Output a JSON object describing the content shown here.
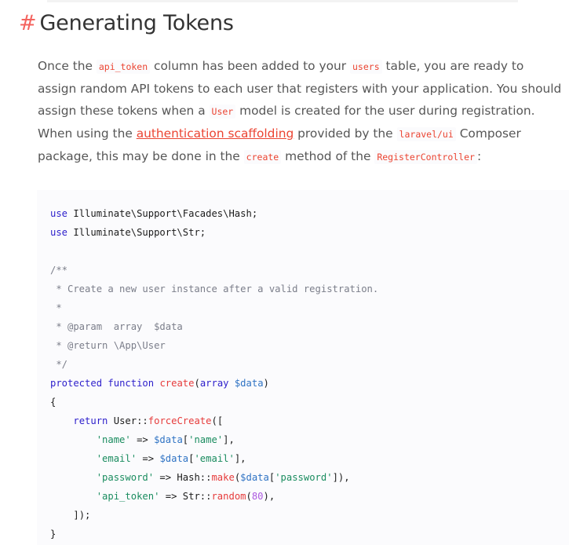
{
  "heading": {
    "hash": "#",
    "title": "Generating Tokens"
  },
  "paragraph": {
    "l1_a": "Once the ",
    "l1_code1": "api_token",
    "l1_b": " column has been added to your ",
    "l1_code2": "users",
    "l1_c": " table, you are ready to",
    "l2": "assign random API tokens to each user that registers with your application. You should",
    "l3_a": "assign these tokens when a ",
    "l3_code": "User",
    "l3_b": " model is created for the user during registration.",
    "l4_a": "When using the ",
    "l4_link": "authentication scaffolding",
    "l4_b": " provided by the ",
    "l4_code": "laravel/ui",
    "l4_c": " Composer",
    "l5_a": "package, this may be done in the ",
    "l5_code1": "create",
    "l5_b": " method of the ",
    "l5_code2": "RegisterController",
    "l5_c": ":"
  },
  "code": {
    "use1_kw": "use",
    "use1_rest": " Illuminate\\Support\\Facades\\Hash;",
    "use2_kw": "use",
    "use2_rest": " Illuminate\\Support\\Str;",
    "c1": "/**",
    "c2": " * Create a new user instance after a valid registration.",
    "c3": " *",
    "c4": " * @param  array  $data",
    "c5": " * @return \\App\\User",
    "c6": " */",
    "sig_kw1": "protected",
    "sig_kw2": "function",
    "sig_fn": "create",
    "sig_p1": "(",
    "sig_type": "array",
    "sig_var": "$data",
    "sig_p2": ")",
    "open_brace": "{",
    "ret_kw": "return",
    "ret_class": " User::",
    "ret_fn": "forceCreate",
    "ret_open": "([",
    "r1_key": "'name'",
    "r1_arrow": " => ",
    "r1_var": "$data",
    "r1_idx": "'name'",
    "r2_key": "'email'",
    "r2_arrow": " => ",
    "r2_var": "$data",
    "r2_idx": "'email'",
    "r3_key": "'password'",
    "r3_arrow": " => Hash::",
    "r3_fn": "make",
    "r3_var": "$data",
    "r3_idx": "'password'",
    "r4_key": "'api_token'",
    "r4_arrow": " => Str::",
    "r4_fn": "random",
    "r4_num": "80",
    "close_arr": "]);",
    "close_brace": "}"
  }
}
